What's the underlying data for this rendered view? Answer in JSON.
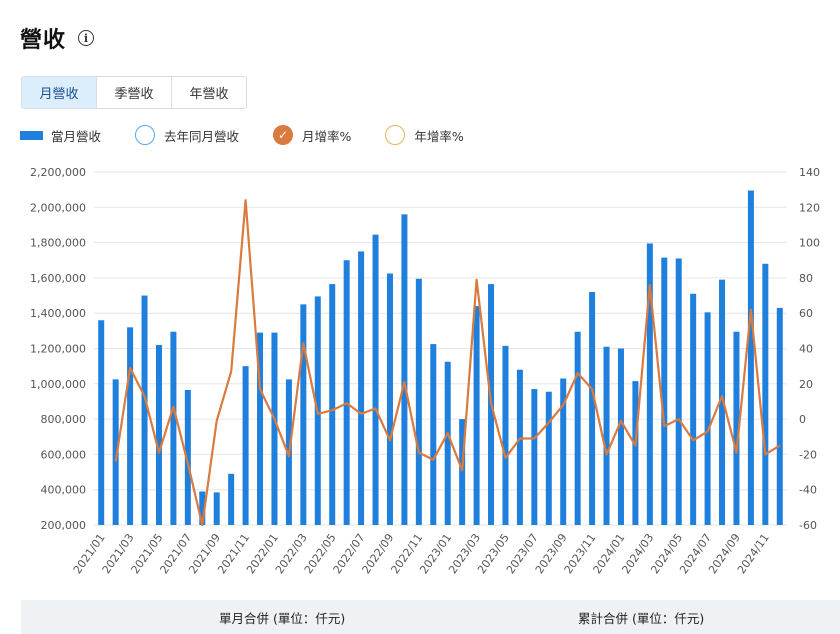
{
  "page": {
    "title": "營收",
    "info_icon": "info-icon"
  },
  "tabs": [
    {
      "label": "月營收",
      "active": true
    },
    {
      "label": "季營收",
      "active": false
    },
    {
      "label": "年營收",
      "active": false
    }
  ],
  "legend": [
    {
      "label": "當月營收",
      "icon": "bar-swatch"
    },
    {
      "label": "去年同月營收",
      "icon": "circle-outline"
    },
    {
      "label": "月增率%",
      "icon": "check-circle"
    },
    {
      "label": "年增率%",
      "icon": "circle-outline"
    }
  ],
  "colors": {
    "bar": "#1f7fdc",
    "line": "#d97a3e",
    "prev_year": "#5aa6ee",
    "yoy": "#eab35a",
    "grid": "#e6e6e6",
    "axis_text": "#555555"
  },
  "chart_data": {
    "type": "bar",
    "x": [
      "2021/01",
      "2021/02",
      "2021/03",
      "2021/04",
      "2021/05",
      "2021/06",
      "2021/07",
      "2021/08",
      "2021/09",
      "2021/10",
      "2021/11",
      "2021/12",
      "2022/01",
      "2022/02",
      "2022/03",
      "2022/04",
      "2022/05",
      "2022/06",
      "2022/07",
      "2022/08",
      "2022/09",
      "2022/10",
      "2022/11",
      "2022/12",
      "2023/01",
      "2023/02",
      "2023/03",
      "2023/04",
      "2023/05",
      "2023/06",
      "2023/07",
      "2023/08",
      "2023/09",
      "2023/10",
      "2023/11",
      "2023/12",
      "2024/01",
      "2024/02",
      "2024/03",
      "2024/04",
      "2024/05",
      "2024/06",
      "2024/07",
      "2024/08",
      "2024/09",
      "2024/10",
      "2024/11",
      "2024/12"
    ],
    "x_tick_labels": [
      "2021/01",
      "2021/03",
      "2021/05",
      "2021/07",
      "2021/09",
      "2021/11",
      "2022/01",
      "2022/03",
      "2022/05",
      "2022/07",
      "2022/09",
      "2022/11",
      "2023/01",
      "2023/03",
      "2023/05",
      "2023/07",
      "2023/09",
      "2023/11",
      "2024/01",
      "2024/03",
      "2024/05",
      "2024/07",
      "2024/09",
      "2024/11"
    ],
    "series": [
      {
        "name": "當月營收",
        "type": "bar",
        "axis": "left",
        "values": [
          1360000,
          1025000,
          1320000,
          1500000,
          1220000,
          1295000,
          965000,
          390000,
          385000,
          490000,
          1100000,
          1290000,
          1290000,
          1025000,
          1450000,
          1495000,
          1565000,
          1700000,
          1750000,
          1845000,
          1625000,
          1960000,
          1595000,
          1225000,
          1125000,
          800000,
          1440000,
          1565000,
          1215000,
          1080000,
          970000,
          955000,
          1030000,
          1295000,
          1520000,
          1210000,
          1200000,
          1015000,
          1795000,
          1715000,
          1710000,
          1510000,
          1405000,
          1590000,
          1295000,
          2095000,
          1680000,
          1430000
        ]
      },
      {
        "name": "月增率%",
        "type": "line",
        "axis": "right",
        "values": [
          null,
          -24,
          29,
          13,
          -19,
          7,
          -25,
          -60,
          -1,
          27,
          124,
          17,
          0,
          -21,
          43,
          3,
          5,
          9,
          3,
          6,
          -12,
          21,
          -19,
          -23,
          -8,
          -29,
          79,
          9,
          -22,
          -11,
          -11,
          -2,
          8,
          26,
          17,
          -20,
          -1,
          -15,
          76,
          -4,
          0,
          -12,
          -7,
          13,
          -19,
          62,
          -20,
          -15
        ]
      }
    ],
    "y_left": {
      "min": 200000,
      "max": 2200000,
      "ticks": [
        "200,000",
        "400,000",
        "600,000",
        "800,000",
        "1,000,000",
        "1,200,000",
        "1,400,000",
        "1,600,000",
        "1,800,000",
        "2,000,000",
        "2,200,000"
      ]
    },
    "y_right": {
      "min": -60,
      "max": 140,
      "ticks": [
        "-60",
        "-40",
        "-20",
        "0",
        "20",
        "40",
        "60",
        "80",
        "100",
        "120",
        "140"
      ]
    },
    "grid": true,
    "legend_position": "top-left"
  },
  "footer": {
    "monthly_label": "單月合併 (單位：仟元)",
    "cumulative_label": "累計合併 (單位：仟元)"
  }
}
